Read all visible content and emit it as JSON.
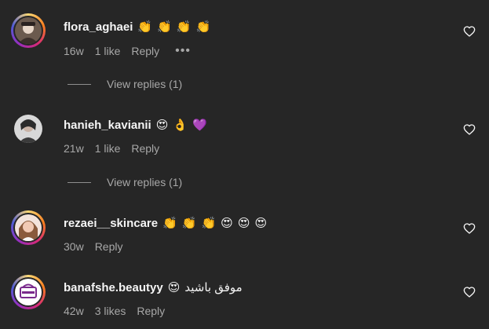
{
  "comments": [
    {
      "username": "flora_aghaei",
      "text": "",
      "emojis": [
        "👏",
        "👏",
        "👏",
        "👏"
      ],
      "time": "16w",
      "likes": "1 like",
      "reply_label": "Reply",
      "more_label": "•••",
      "view_replies": "View replies (1)"
    },
    {
      "username": "hanieh_kavianii",
      "text": "",
      "emojis": [
        "😍",
        "👌",
        "💜"
      ],
      "time": "21w",
      "likes": "1 like",
      "reply_label": "Reply",
      "view_replies": "View replies (1)"
    },
    {
      "username": "rezaei__skincare",
      "text": "",
      "emojis": [
        "👏",
        "👏",
        "👏",
        "😍",
        "😍",
        "😍"
      ],
      "time": "30w",
      "likes": "",
      "reply_label": "Reply"
    },
    {
      "username": "banafshe.beautyy",
      "text": "موفق باشید",
      "emojis": [
        "😍"
      ],
      "time": "42w",
      "likes": "3 likes",
      "reply_label": "Reply"
    }
  ],
  "colors": {
    "background": "#262626",
    "primary_text": "#f5f5f5",
    "secondary_text": "#a8a8a8",
    "story_ring": "#d62976"
  },
  "icons": {
    "like": "heart-outline-icon"
  }
}
